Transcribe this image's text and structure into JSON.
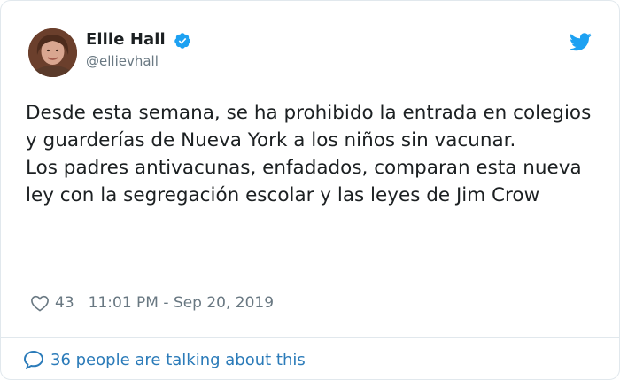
{
  "author": {
    "name": "Ellie Hall",
    "handle": "@ellievhall",
    "verified": true
  },
  "tweet": {
    "paragraphs": [
      "Desde esta semana, se ha prohibido la entrada en colegios y guarderías de Nueva York a los niños sin vacunar.",
      "Los padres antivacunas, enfadados, comparan esta nueva ley con la segregación escolar y las leyes de Jim Crow"
    ]
  },
  "meta": {
    "likes": "43",
    "timestamp": "11:01 PM - Sep 20, 2019"
  },
  "footer": {
    "talking": "36 people are talking about this"
  },
  "colors": {
    "text": "#1c2022",
    "secondary": "#697882",
    "link": "#2b7bb9",
    "twitter_blue": "#1da1f2",
    "border": "#e1e8ed"
  },
  "icons": {
    "verified": "verified-badge-icon",
    "brand": "twitter-bird-icon",
    "like": "heart-icon",
    "reply": "speech-bubble-icon"
  }
}
